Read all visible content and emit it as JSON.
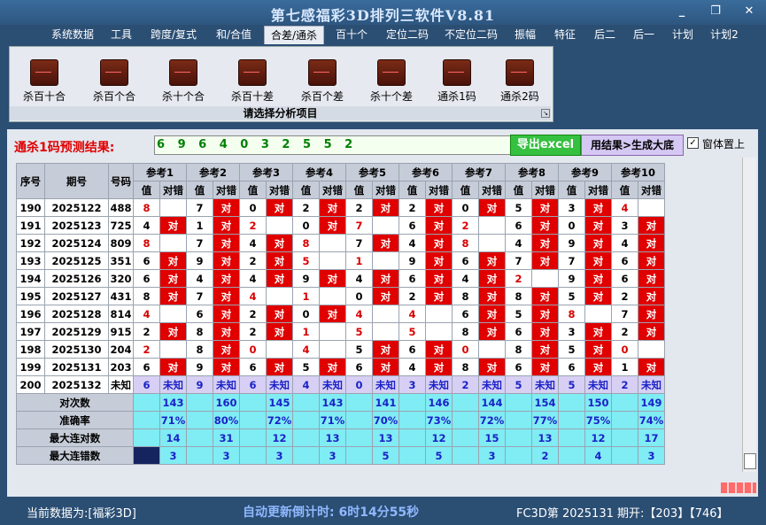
{
  "window": {
    "title": "第七感福彩3D排列三软件V8.81",
    "controls": [
      "_",
      "❐",
      "✕"
    ]
  },
  "menu": [
    "系统数据",
    "工具",
    "跨度/复式",
    "和/合值",
    "合差/通杀",
    "百十个",
    "定位二码",
    "不定位二码",
    "振幅",
    "特征",
    "后二",
    "后一",
    "计划",
    "计划2"
  ],
  "menu_active": "合差/通杀",
  "ribbon": {
    "buttons": [
      "杀百十合",
      "杀百个合",
      "杀十个合",
      "杀百十差",
      "杀百个差",
      "杀十个差",
      "通杀1码",
      "通杀2码"
    ],
    "caption": "请选择分析项目"
  },
  "prediction": {
    "label": "通杀1码预测结果:",
    "value": "6 9 6 4 0 3 2 5 5 2",
    "export_button": "导出excel",
    "result_button": "用结果>生成大底",
    "checkbox_label": "窗体置上",
    "checkbox_checked": true
  },
  "table": {
    "headers": {
      "seq": "序号",
      "period": "期号",
      "number": "号码",
      "value": "值",
      "check": "对错",
      "refs": [
        "参考1",
        "参考2",
        "参考3",
        "参考4",
        "参考5",
        "参考6",
        "参考7",
        "参考8",
        "参考9",
        "参考10"
      ]
    },
    "rows": [
      {
        "seq": "190",
        "period": "2025122",
        "num": "488",
        "vals": [
          "8",
          "7",
          "0",
          "2",
          "2",
          "2",
          "0",
          "5",
          "3",
          "4"
        ],
        "hits": [
          0,
          1,
          1,
          1,
          1,
          1,
          1,
          1,
          1,
          0
        ],
        "red": [
          0,
          9
        ]
      },
      {
        "seq": "191",
        "period": "2025123",
        "num": "725",
        "vals": [
          "4",
          "1",
          "2",
          "0",
          "7",
          "6",
          "2",
          "6",
          "0",
          "3"
        ],
        "hits": [
          1,
          1,
          0,
          1,
          0,
          1,
          0,
          1,
          1,
          1
        ],
        "red": [
          2,
          4,
          6
        ]
      },
      {
        "seq": "192",
        "period": "2025124",
        "num": "809",
        "vals": [
          "8",
          "7",
          "4",
          "8",
          "7",
          "4",
          "8",
          "4",
          "9",
          "4"
        ],
        "hits": [
          0,
          1,
          1,
          0,
          1,
          1,
          0,
          1,
          1,
          1
        ],
        "red": [
          0,
          3,
          6
        ]
      },
      {
        "seq": "193",
        "period": "2025125",
        "num": "351",
        "vals": [
          "6",
          "9",
          "2",
          "5",
          "1",
          "9",
          "6",
          "7",
          "7",
          "6"
        ],
        "hits": [
          1,
          1,
          1,
          0,
          0,
          1,
          1,
          1,
          1,
          1
        ],
        "red": [
          3,
          4
        ]
      },
      {
        "seq": "194",
        "period": "2025126",
        "num": "320",
        "vals": [
          "6",
          "4",
          "4",
          "9",
          "4",
          "6",
          "4",
          "2",
          "9",
          "6"
        ],
        "hits": [
          1,
          1,
          1,
          1,
          1,
          1,
          1,
          0,
          1,
          1
        ],
        "red": [
          7
        ]
      },
      {
        "seq": "195",
        "period": "2025127",
        "num": "431",
        "vals": [
          "8",
          "7",
          "4",
          "1",
          "0",
          "2",
          "8",
          "8",
          "5",
          "2"
        ],
        "hits": [
          1,
          1,
          0,
          0,
          1,
          1,
          1,
          1,
          1,
          1
        ],
        "red": [
          2,
          3
        ]
      },
      {
        "seq": "196",
        "period": "2025128",
        "num": "814",
        "vals": [
          "4",
          "6",
          "2",
          "0",
          "4",
          "4",
          "6",
          "5",
          "8",
          "7"
        ],
        "hits": [
          0,
          1,
          1,
          1,
          0,
          0,
          1,
          1,
          0,
          1
        ],
        "red": [
          0,
          4,
          5,
          8
        ]
      },
      {
        "seq": "197",
        "period": "2025129",
        "num": "915",
        "vals": [
          "2",
          "8",
          "2",
          "1",
          "5",
          "5",
          "8",
          "6",
          "3",
          "2"
        ],
        "hits": [
          1,
          1,
          1,
          0,
          0,
          0,
          1,
          1,
          1,
          1
        ],
        "red": [
          3,
          4,
          5
        ]
      },
      {
        "seq": "198",
        "period": "2025130",
        "num": "204",
        "vals": [
          "2",
          "8",
          "0",
          "4",
          "5",
          "6",
          "0",
          "8",
          "5",
          "0"
        ],
        "hits": [
          0,
          1,
          0,
          0,
          1,
          1,
          0,
          1,
          1,
          0
        ],
        "red": [
          0,
          2,
          3,
          6,
          9
        ]
      },
      {
        "seq": "199",
        "period": "2025131",
        "num": "203",
        "vals": [
          "6",
          "9",
          "6",
          "5",
          "6",
          "4",
          "8",
          "6",
          "6",
          "1"
        ],
        "hits": [
          1,
          1,
          1,
          1,
          1,
          1,
          1,
          1,
          1,
          1
        ],
        "red": []
      },
      {
        "seq": "200",
        "period": "2025132",
        "num": "未知",
        "vals": [
          "6",
          "9",
          "6",
          "4",
          "0",
          "3",
          "2",
          "5",
          "5",
          "2"
        ],
        "unknown": "未知"
      }
    ],
    "stats": [
      {
        "label": "对次数",
        "values": [
          "143",
          "160",
          "145",
          "143",
          "141",
          "146",
          "144",
          "154",
          "150",
          "149"
        ]
      },
      {
        "label": "准确率",
        "values": [
          "71%",
          "80%",
          "72%",
          "71%",
          "70%",
          "73%",
          "72%",
          "77%",
          "75%",
          "74%"
        ]
      },
      {
        "label": "最大连对数",
        "values": [
          "14",
          "31",
          "12",
          "13",
          "13",
          "12",
          "15",
          "13",
          "12",
          "17"
        ]
      },
      {
        "label": "最大连错数",
        "values": [
          "3",
          "3",
          "3",
          "3",
          "5",
          "5",
          "3",
          "2",
          "4",
          "3"
        ]
      }
    ],
    "check_text": "对"
  },
  "status": {
    "current_data": "当前数据为:[福彩3D]",
    "countdown": "自动更新倒计时: 6时14分55秒",
    "last_draw": "FC3D第 2025131 期开:【203】【746】"
  },
  "colors": {
    "hit_red": "#e00000",
    "unknown_purple": "#d8cff4",
    "stat_cyan": "#80ecf4",
    "stat_text_blue": "#1a22c8"
  }
}
